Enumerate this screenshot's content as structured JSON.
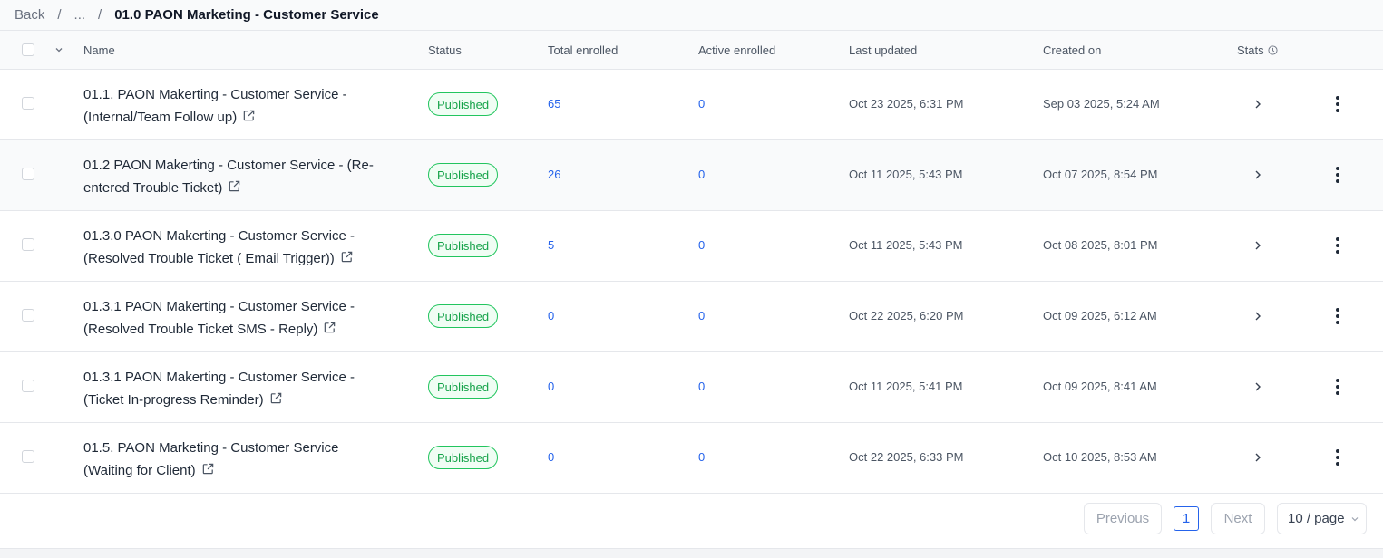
{
  "breadcrumb": {
    "back": "Back",
    "ellipsis": "...",
    "separator": "/",
    "current": "01.0 PAON Marketing - Customer Service"
  },
  "table": {
    "columns": {
      "name": "Name",
      "status": "Status",
      "total_enrolled": "Total enrolled",
      "active_enrolled": "Active enrolled",
      "last_updated": "Last updated",
      "created_on": "Created on",
      "stats": "Stats"
    },
    "rows": [
      {
        "name_line1": "01.1. PAON Makerting - Customer Service -",
        "name_line2": "(Internal/Team Follow up)",
        "status": "Published",
        "total_enrolled": "65",
        "active_enrolled": "0",
        "last_updated": "Oct 23 2025, 6:31 PM",
        "created_on": "Sep 03 2025, 5:24 AM"
      },
      {
        "name_line1": "01.2 PAON Makerting - Customer Service - (Re-",
        "name_line2": "entered Trouble Ticket)",
        "status": "Published",
        "total_enrolled": "26",
        "active_enrolled": "0",
        "last_updated": "Oct 11 2025, 5:43 PM",
        "created_on": "Oct 07 2025, 8:54 PM"
      },
      {
        "name_line1": "01.3.0 PAON Makerting - Customer Service -",
        "name_line2": "(Resolved Trouble Ticket ( Email Trigger))",
        "status": "Published",
        "total_enrolled": "5",
        "active_enrolled": "0",
        "last_updated": "Oct 11 2025, 5:43 PM",
        "created_on": "Oct 08 2025, 8:01 PM"
      },
      {
        "name_line1": "01.3.1 PAON Makerting - Customer Service -",
        "name_line2": "(Resolved Trouble Ticket SMS - Reply)",
        "status": "Published",
        "total_enrolled": "0",
        "active_enrolled": "0",
        "last_updated": "Oct 22 2025, 6:20 PM",
        "created_on": "Oct 09 2025, 6:12 AM"
      },
      {
        "name_line1": "01.3.1 PAON Makerting - Customer Service -",
        "name_line2": "(Ticket In-progress Reminder)",
        "status": "Published",
        "total_enrolled": "0",
        "active_enrolled": "0",
        "last_updated": "Oct 11 2025, 5:41 PM",
        "created_on": "Oct 09 2025, 8:41 AM"
      },
      {
        "name_line1": "01.5. PAON Marketing - Customer Service",
        "name_line2": "(Waiting for Client)",
        "status": "Published",
        "total_enrolled": "0",
        "active_enrolled": "0",
        "last_updated": "Oct 22 2025, 6:33 PM",
        "created_on": "Oct 10 2025, 8:53 AM"
      }
    ]
  },
  "pagination": {
    "previous": "Previous",
    "current_page": "1",
    "next": "Next",
    "page_size": "10 / page"
  },
  "icons": {
    "external_link": "external-link-icon",
    "row_chevron": "chevron-right-icon",
    "row_menu": "more-vertical-icon",
    "stats_info": "info-icon",
    "header_expand": "chevron-down-icon"
  },
  "colors": {
    "accent": "#2563eb",
    "published": "#16a34a",
    "published_bg": "#f0fdf4"
  }
}
